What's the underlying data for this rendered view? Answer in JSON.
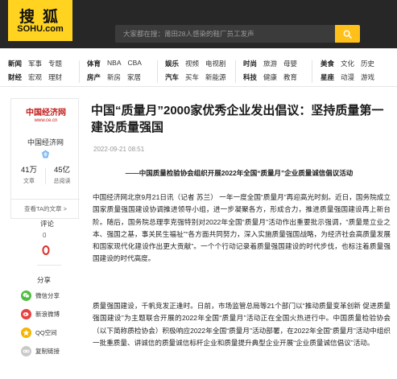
{
  "header": {
    "logo_cn": "搜狐",
    "logo_en": "SOHU.com",
    "search_placeholder": "大家都在搜：莆田28人感染的鞋厂员工发声"
  },
  "nav": {
    "groups": [
      {
        "rows": [
          [
            "新闻",
            "军事",
            "专题"
          ],
          [
            "财经",
            "宏观",
            "理财"
          ]
        ]
      },
      {
        "rows": [
          [
            "体育",
            "NBA",
            "CBA"
          ],
          [
            "房产",
            "新房",
            "家居"
          ]
        ]
      },
      {
        "rows": [
          [
            "娱乐",
            "视频",
            "电视剧"
          ],
          [
            "汽车",
            "买车",
            "新能源"
          ]
        ]
      },
      {
        "rows": [
          [
            "时尚",
            "旅游",
            "母婴"
          ],
          [
            "科技",
            "健康",
            "教育"
          ]
        ]
      },
      {
        "rows": [
          [
            "美食",
            "文化",
            "历史"
          ],
          [
            "星座",
            "动漫",
            "游戏"
          ]
        ]
      }
    ]
  },
  "author": {
    "logo_line1": "中国经济网",
    "logo_line2": "www.ce.cn",
    "name": "中国经济网",
    "articles_num": "41万",
    "articles_label": "文章",
    "visits_num": "45亿",
    "visits_label": "总阅读",
    "view_all": "查看TA的文章 >"
  },
  "comments": {
    "label": "评论",
    "count": "0"
  },
  "share": {
    "label": "分享",
    "items": [
      {
        "label": "微信分享",
        "icon": "wechat-icon",
        "color": "#4fbf40"
      },
      {
        "label": "新浪微博",
        "icon": "weibo-icon",
        "color": "#e8413e"
      },
      {
        "label": "QQ空间",
        "icon": "qzone-icon",
        "color": "#f5b400"
      },
      {
        "label": "复制链接",
        "icon": "link-icon",
        "color": "#c9c9c9"
      }
    ]
  },
  "article": {
    "title": "中国“质量月”2000家优秀企业发出倡议：坚持质量第一 建设质量强国",
    "datetime": "2022-09-21 08:51",
    "lead": "——中国质量检验协会组织开展2022年全国“质量月”企业质量诚信倡议活动",
    "paragraphs": [
      "中国经济网北京9月21日讯（记者 苏兰） 一年一度全国“质量月”再迎高光时刻。近日，国务院成立国家质量强国建设协调推进领导小组，进一步凝聚各方，形成合力，推进质量强国建设再上新台阶。随后，国务院总理李克强特别对2022年全国“质量月”活动作出重要批示强调，“质量是立业之本、强国之基，事关民生福祉”“各方面共同努力，深入实施质量强国战略，为经济社会高质量发展和国家现代化建设作出更大贡献”。一个个行动记录着质量强国建设的时代步伐，也标注着质量强国建设的时代高度。",
      "质量强国建设，千帆竞发正逢时。日前，市场监管总局等21个部门以“推动质量变革创新 促进质量强国建设”为主题联合开展的2022年全国“质量月”活动正在全国火热进行中。中国质量检验协会（以下简称质检协会）积极响应2022年全国“质量月”活动部署，在2022年全国“质量月”活动中组织一批重质量、讲诚信的质量诚信标杆企业和质量提升典型企业开展“企业质量诚信倡议”活动。"
    ]
  },
  "colors": {
    "topbar": "#272727",
    "logo_bg": "#ffd31f",
    "search_btn": "#ffc019",
    "brand_red": "#c21d1d"
  }
}
